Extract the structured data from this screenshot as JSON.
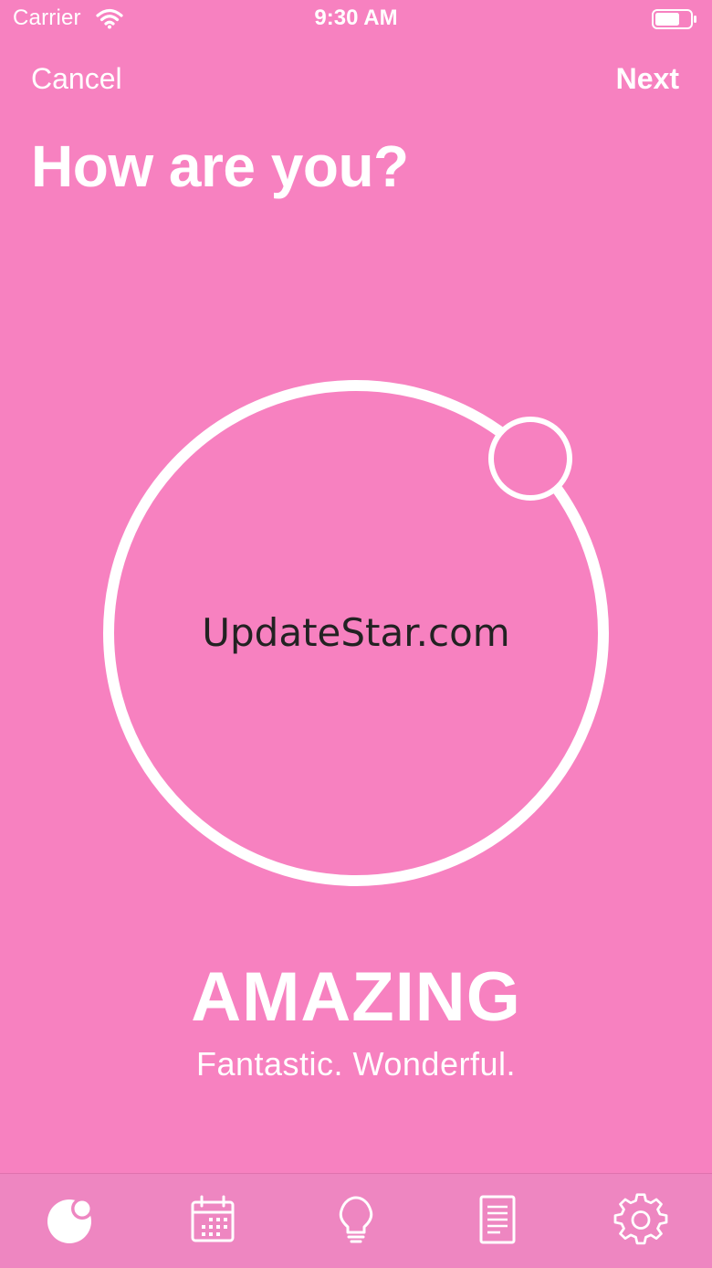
{
  "status_bar": {
    "carrier": "Carrier",
    "time": "9:30 AM",
    "icons": [
      "wifi-icon",
      "battery-icon"
    ]
  },
  "nav": {
    "cancel_label": "Cancel",
    "next_label": "Next"
  },
  "page": {
    "title": "How are you?"
  },
  "mood": {
    "label": "AMAZING",
    "description": "Fantastic. Wonderful."
  },
  "watermark": "UpdateStar.com",
  "tab_bar": {
    "tabs": [
      {
        "icon": "mood-icon",
        "active": true
      },
      {
        "icon": "calendar-icon",
        "active": false
      },
      {
        "icon": "lightbulb-icon",
        "active": false
      },
      {
        "icon": "document-icon",
        "active": false
      },
      {
        "icon": "gear-icon",
        "active": false
      }
    ]
  },
  "colors": {
    "background": "#f781c0",
    "tab_bar": "#ee86c1",
    "foreground": "#ffffff"
  }
}
